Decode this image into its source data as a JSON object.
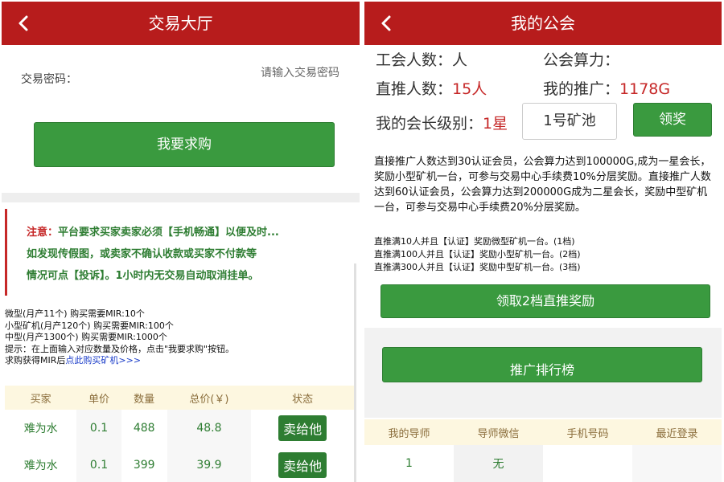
{
  "colors": {
    "header": "#b71c1c",
    "button": "#3a9a3f",
    "accent_red": "#c62828",
    "accent_green": "#2e7d32"
  },
  "left": {
    "header": {
      "title": "交易大厅",
      "back_icon": "chevron-left-icon"
    },
    "password": {
      "label": "交易密码：",
      "placeholder": "请输入交易密码"
    },
    "buy_button": "我要求购",
    "notice": {
      "prefix": "注意：",
      "line1": "平台要求买家卖家必须【手机畅通】以便及时...",
      "line2": "如发现传假图，或卖家不确认收款或买家不付款等",
      "line3": "情况可点【投诉】。1小时内无交易自动取消挂单。"
    },
    "info": {
      "line1": "微型(月产11个) 购买需要MIR:10个",
      "line2": "小型矿机(月产120个) 购买需要MIR:100个",
      "line3": "中型(月产1300个) 购买需要MIR:1000个",
      "line4": "提示：在上面输入对应数量及价格，点击\"我要求购\"按钮。",
      "line5_prefix": "求购获得MIR后",
      "line5_link": "点此购买矿机>>>"
    },
    "table": {
      "headers": [
        "买家",
        "单价",
        "数量",
        "总价(￥)",
        "状态"
      ],
      "rows": [
        {
          "buyer": "难为水",
          "price": "0.1",
          "qty": "488",
          "total": "48.8",
          "action": "卖给他"
        },
        {
          "buyer": "难为水",
          "price": "0.1",
          "qty": "399",
          "total": "39.9",
          "action": "卖给他"
        }
      ]
    }
  },
  "right": {
    "header": {
      "title": "我的公会",
      "back_icon": "chevron-left-icon"
    },
    "guild_members": {
      "label": "工会人数：",
      "value": "人"
    },
    "guild_power": {
      "label": "公会算力：",
      "value": ""
    },
    "direct_count": {
      "label": "直推人数：",
      "value": "15人"
    },
    "my_promotion": {
      "label": "我的推广：",
      "value": "1178G"
    },
    "level": {
      "label": "我的会长级别：",
      "value": "1星"
    },
    "pool_select": "1号矿池",
    "claim_button": "领奖",
    "description": "直接推广人数达到30认证会员，公会算力达到100000G,成为一星会长，奖励小型矿机一台，可参与交易中心手续费10%分层奖励。直接推广人数达到60认证会员，公会算力达到200000G成为二星会长，奖励中型矿机一台，可参与交易中心手续费20%分层奖励。",
    "rules": [
      "直推满10人并且【认证】奖励微型矿机一台。(1档)",
      "直推满100人并且【认证】奖励小型矿机一台。(2档)",
      "直推满300人并且【认证】奖励中型矿机一台。(3档)"
    ],
    "reward_button": "领取2档直推奖励",
    "rank_button": "推广排行榜",
    "mentor_table": {
      "headers": [
        "我的导师",
        "导师微信",
        "手机号码",
        "最近登录"
      ],
      "row": [
        "1",
        "无",
        "",
        ""
      ]
    }
  }
}
